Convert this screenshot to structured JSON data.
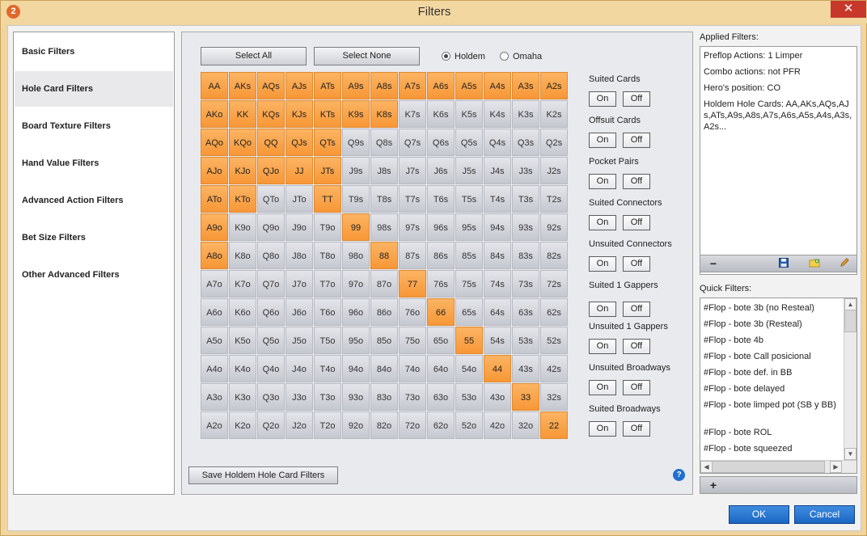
{
  "window": {
    "title": "Filters",
    "app_icon": "2",
    "close_glyph": "✕"
  },
  "left_nav": {
    "items": [
      {
        "label": "Basic Filters",
        "active": false
      },
      {
        "label": "Hole Card Filters",
        "active": true
      },
      {
        "label": "Board Texture Filters",
        "active": false
      },
      {
        "label": "Hand Value Filters",
        "active": false
      },
      {
        "label": "Advanced Action Filters",
        "active": false
      },
      {
        "label": "Bet Size Filters",
        "active": false
      },
      {
        "label": "Other Advanced Filters",
        "active": false
      }
    ]
  },
  "center": {
    "select_all": "Select All",
    "select_none": "Select None",
    "game_options": [
      {
        "label": "Holdem",
        "selected": true
      },
      {
        "label": "Omaha",
        "selected": false
      }
    ],
    "grid": {
      "rows": [
        [
          "AA",
          "AKs",
          "AQs",
          "AJs",
          "ATs",
          "A9s",
          "A8s",
          "A7s",
          "A6s",
          "A5s",
          "A4s",
          "A3s",
          "A2s"
        ],
        [
          "AKo",
          "KK",
          "KQs",
          "KJs",
          "KTs",
          "K9s",
          "K8s",
          "K7s",
          "K6s",
          "K5s",
          "K4s",
          "K3s",
          "K2s"
        ],
        [
          "AQo",
          "KQo",
          "QQ",
          "QJs",
          "QTs",
          "Q9s",
          "Q8s",
          "Q7s",
          "Q6s",
          "Q5s",
          "Q4s",
          "Q3s",
          "Q2s"
        ],
        [
          "AJo",
          "KJo",
          "QJo",
          "JJ",
          "JTs",
          "J9s",
          "J8s",
          "J7s",
          "J6s",
          "J5s",
          "J4s",
          "J3s",
          "J2s"
        ],
        [
          "ATo",
          "KTo",
          "QTo",
          "JTo",
          "TT",
          "T9s",
          "T8s",
          "T7s",
          "T6s",
          "T5s",
          "T4s",
          "T3s",
          "T2s"
        ],
        [
          "A9o",
          "K9o",
          "Q9o",
          "J9o",
          "T9o",
          "99",
          "98s",
          "97s",
          "96s",
          "95s",
          "94s",
          "93s",
          "92s"
        ],
        [
          "A8o",
          "K8o",
          "Q8o",
          "J8o",
          "T8o",
          "98o",
          "88",
          "87s",
          "86s",
          "85s",
          "84s",
          "83s",
          "82s"
        ],
        [
          "A7o",
          "K7o",
          "Q7o",
          "J7o",
          "T7o",
          "97o",
          "87o",
          "77",
          "76s",
          "75s",
          "74s",
          "73s",
          "72s"
        ],
        [
          "A6o",
          "K6o",
          "Q6o",
          "J6o",
          "T6o",
          "96o",
          "86o",
          "76o",
          "66",
          "65s",
          "64s",
          "63s",
          "62s"
        ],
        [
          "A5o",
          "K5o",
          "Q5o",
          "J5o",
          "T5o",
          "95o",
          "85o",
          "75o",
          "65o",
          "55",
          "54s",
          "53s",
          "52s"
        ],
        [
          "A4o",
          "K4o",
          "Q4o",
          "J4o",
          "T4o",
          "94o",
          "84o",
          "74o",
          "64o",
          "54o",
          "44",
          "43s",
          "42s"
        ],
        [
          "A3o",
          "K3o",
          "Q3o",
          "J3o",
          "T3o",
          "93o",
          "83o",
          "73o",
          "63o",
          "53o",
          "43o",
          "33",
          "32s"
        ],
        [
          "A2o",
          "K2o",
          "Q2o",
          "J2o",
          "T2o",
          "92o",
          "82o",
          "72o",
          "62o",
          "52o",
          "42o",
          "32o",
          "22"
        ]
      ],
      "selected": [
        "AA",
        "AKs",
        "AQs",
        "AJs",
        "ATs",
        "A9s",
        "A8s",
        "A7s",
        "A6s",
        "A5s",
        "A4s",
        "A3s",
        "A2s",
        "AKo",
        "KK",
        "KQs",
        "KJs",
        "KTs",
        "K9s",
        "K8s",
        "AQo",
        "KQo",
        "QQ",
        "QJs",
        "QTs",
        "AJo",
        "KJo",
        "QJo",
        "JJ",
        "JTs",
        "ATo",
        "KTo",
        "TT",
        "A9o",
        "99",
        "A8o",
        "88",
        "77",
        "66",
        "55",
        "44",
        "33",
        "22"
      ],
      "colors": {
        "selected": "#f89a3a",
        "unselected": "#d4d6dd"
      }
    },
    "categories": [
      {
        "label": "Suited Cards",
        "on": "On",
        "off": "Off"
      },
      {
        "label": "Offsuit Cards",
        "on": "On",
        "off": "Off"
      },
      {
        "label": "Pocket Pairs",
        "on": "On",
        "off": "Off"
      },
      {
        "label": "Suited Connectors",
        "on": "On",
        "off": "Off"
      },
      {
        "label": "Unsuited Connectors",
        "on": "On",
        "off": "Off"
      },
      {
        "label": "Suited 1 Gappers",
        "on": "On",
        "off": "Off"
      },
      {
        "label": "Unsuited 1 Gappers",
        "on": "On",
        "off": "Off"
      },
      {
        "label": "Unsuited Broadways",
        "on": "On",
        "off": "Off"
      },
      {
        "label": "Suited Broadways",
        "on": "On",
        "off": "Off"
      }
    ],
    "save_button": "Save Holdem Hole Card Filters",
    "help_icon": "?"
  },
  "applied": {
    "label": "Applied Filters:",
    "lines": [
      "Preflop Actions: 1 Limper",
      "Combo actions: not PFR",
      "Hero's position: CO",
      "Holdem Hole Cards: AA,AKs,AQs,AJs,ATs,A9s,A8s,A7s,A6s,A5s,A4s,A3s,A2s..."
    ],
    "toolbar_icons": [
      "minus-icon",
      "save-icon",
      "add-folder-icon",
      "edit-icon"
    ]
  },
  "quick": {
    "label": "Quick Filters:",
    "items": [
      "#Flop - bote 3b (no Resteal)",
      "#Flop - bote 3b (Resteal)",
      "#Flop - bote 4b",
      "#Flop - bote Call posicional",
      "#Flop - bote def. in BB",
      "#Flop - bote delayed",
      "#Flop - bote limped pot (SB y BB)",
      "#Flop - bote ROL",
      "#Flop - bote squeezed"
    ],
    "add_glyph": "+"
  },
  "footer": {
    "ok": "OK",
    "cancel": "Cancel"
  }
}
